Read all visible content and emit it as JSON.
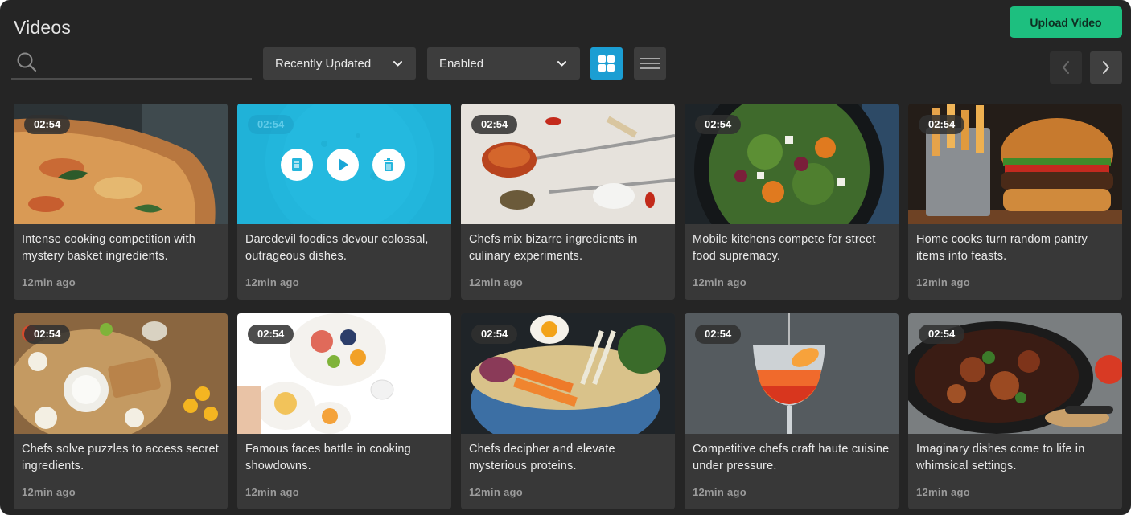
{
  "header": {
    "title": "Videos",
    "upload_label": "Upload Video"
  },
  "filters": {
    "search_placeholder": "",
    "sort_value": "Recently Updated",
    "status_value": "Enabled"
  },
  "view_toggle": {
    "active": "grid",
    "grid_icon": "grid-view-icon",
    "list_icon": "list-view-icon"
  },
  "pagination": {
    "prev_icon": "chevron-left-icon",
    "next_icon": "chevron-right-icon"
  },
  "colors": {
    "accent_green": "#1dbf7f",
    "accent_blue": "#1b9ed3",
    "background": "#252525",
    "card": "#383838"
  },
  "hover_actions": {
    "card_index": 1,
    "icons": [
      "document-icon",
      "play-icon",
      "trash-icon"
    ]
  },
  "videos": [
    {
      "duration": "02:54",
      "title": "Intense cooking competition with mystery basket ingredients.",
      "time": "12min ago"
    },
    {
      "duration": "02:54",
      "title": "Daredevil foodies devour colossal, outrageous dishes.",
      "time": "12min ago"
    },
    {
      "duration": "02:54",
      "title": "Chefs mix bizarre ingredients in culinary experiments.",
      "time": "12min ago"
    },
    {
      "duration": "02:54",
      "title": "Mobile kitchens compete for street food supremacy.",
      "time": "12min ago"
    },
    {
      "duration": "02:54",
      "title": "Home cooks turn random pantry items into feasts.",
      "time": "12min ago"
    },
    {
      "duration": "02:54",
      "title": "Chefs solve puzzles to access secret ingredients.",
      "time": "12min ago"
    },
    {
      "duration": "02:54",
      "title": "Famous faces battle in cooking showdowns.",
      "time": "12min ago"
    },
    {
      "duration": "02:54",
      "title": "Chefs decipher and elevate mysterious proteins.",
      "time": "12min ago"
    },
    {
      "duration": "02:54",
      "title": "Competitive chefs craft haute cuisine under pressure.",
      "time": "12min ago"
    },
    {
      "duration": "02:54",
      "title": "Imaginary dishes come to life in whimsical settings.",
      "time": "12min ago"
    }
  ]
}
